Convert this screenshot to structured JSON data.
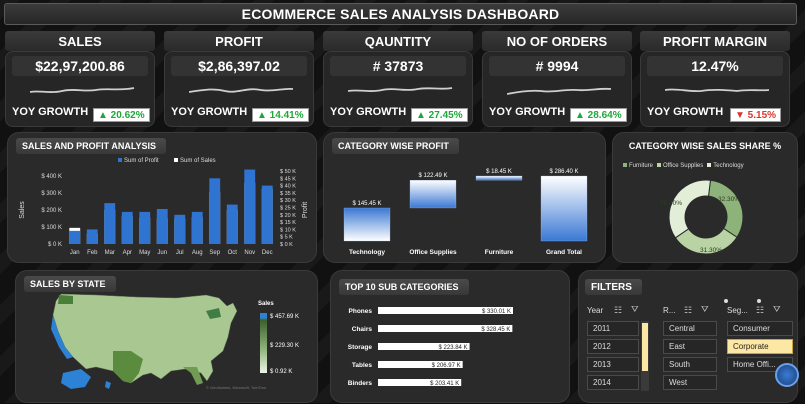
{
  "title": "ECOMMERCE SALES ANALYSIS DASHBOARD",
  "kpis": [
    {
      "label": "SALES",
      "value": "$22,97,200.86",
      "yoy_label": "YOY GROWTH",
      "growth": "▲ 20.62%",
      "trend": "up"
    },
    {
      "label": "PROFIT",
      "value": "$2,86,397.02",
      "yoy_label": "YOY GROWTH",
      "growth": "▲ 14.41%",
      "trend": "up"
    },
    {
      "label": "QAUNTITY",
      "value": "# 37873",
      "yoy_label": "YOY GROWTH",
      "growth": "▲ 27.45%",
      "trend": "up"
    },
    {
      "label": "NO OF ORDERS",
      "value": "# 9994",
      "yoy_label": "YOY GROWTH",
      "growth": "▲ 28.64%",
      "trend": "up"
    },
    {
      "label": "PROFIT MARGIN",
      "value": "12.47%",
      "yoy_label": "YOY GROWTH",
      "growth": "▼ 5.15%",
      "trend": "down"
    }
  ],
  "sales_profit": {
    "title": "SALES AND PROFIT ANALYSIS",
    "legend_profit": "Sum of Profit",
    "legend_sales": "Sum of Sales",
    "ylabel_left": "Sales",
    "ylabel_right": "Profit",
    "left_ticks": [
      "$ 400 K",
      "$ 300 K",
      "$ 200 K",
      "$ 100 K",
      "$ 0 K"
    ],
    "right_ticks": [
      "$ 50 K",
      "$ 45 K",
      "$ 40 K",
      "$ 35 K",
      "$ 30 K",
      "$ 25 K",
      "$ 20 K",
      "$ 15 K",
      "$ 10 K",
      "$ 5 K",
      "$ 0 K"
    ]
  },
  "chart_data": [
    {
      "type": "bar",
      "title": "SALES AND PROFIT ANALYSIS",
      "xlabel": "",
      "ylabel": "Sales",
      "y2label": "Profit",
      "categories": [
        "Jan",
        "Feb",
        "Mar",
        "Apr",
        "May",
        "Jun",
        "Jul",
        "Aug",
        "Sep",
        "Oct",
        "Nov",
        "Dec"
      ],
      "series": [
        {
          "name": "Sum of Sales",
          "values": [
            95,
            60,
            200,
            165,
            155,
            150,
            150,
            160,
            305,
            200,
            360,
            325
          ],
          "axis": "left",
          "unit": "$ K",
          "color": "#ffffff"
        },
        {
          "name": "Sum of Profit",
          "values": [
            9,
            10,
            28,
            22,
            22,
            24,
            20,
            22,
            45,
            27,
            51,
            40
          ],
          "axis": "right",
          "unit": "$ K",
          "color": "#2f74d0"
        }
      ],
      "ylim": [
        0,
        400
      ],
      "y2lim": [
        0,
        50
      ]
    },
    {
      "type": "bar",
      "subtype": "waterfall",
      "title": "CATEGORY WISE PROFIT",
      "categories": [
        "Technology",
        "Office Supplies",
        "Furniture",
        "Grand Total"
      ],
      "values": [
        145.45,
        122.49,
        18.45,
        286.4
      ],
      "labels": [
        "$ 145.45 K",
        "$ 122.49 K",
        "$ 18.45 K",
        "$ 286.40 K"
      ]
    },
    {
      "type": "pie",
      "subtype": "donut",
      "title": "CATEGORY WISE SALES SHARE %",
      "categories": [
        "Furniture",
        "Office Supplies",
        "Technology"
      ],
      "values": [
        32.3,
        31.3,
        36.4
      ],
      "labels": [
        "32.30%",
        "31.30%",
        "36.40%"
      ],
      "colors": [
        "#8eb37a",
        "#b9d3a4",
        "#e3eed9"
      ]
    },
    {
      "type": "bar",
      "subtype": "horizontal",
      "title": "TOP 10 SUB CATEGORIES",
      "categories": [
        "Phones",
        "Chairs",
        "Storage",
        "Tables",
        "Binders"
      ],
      "values": [
        330.01,
        328.45,
        223.84,
        206.97,
        203.41
      ],
      "labels": [
        "$ 330.01 K",
        "$ 328.45 K",
        "$ 223.84 K",
        "$ 206.97 K",
        "$ 203.41 K"
      ]
    }
  ],
  "category_profit": {
    "title": "CATEGORY WISE PROFIT"
  },
  "category_share": {
    "title": "CATEGORY WISE SALES SHARE %",
    "legend": [
      "Furniture",
      "Office Supplies",
      "Technology"
    ]
  },
  "sales_by_state": {
    "title": "SALES BY STATE",
    "legend_title": "Sales",
    "legend_max": "$ 457.69 K",
    "legend_mid": "$ 229.30 K",
    "legend_min": "$ 0.92 K",
    "attribution": "© GeoNames, Microsoft, TomTom"
  },
  "top_sub": {
    "title": "TOP 10 SUB CATEGORIES"
  },
  "filters": {
    "title": "FILTERS",
    "year": {
      "header": "Year",
      "items": [
        "2011",
        "2012",
        "2013",
        "2014"
      ]
    },
    "region": {
      "header": "R...",
      "items": [
        "Central",
        "East",
        "South",
        "West"
      ]
    },
    "segment": {
      "header": "Seg...",
      "items": [
        "Consumer",
        "Corporate",
        "Home Offi..."
      ],
      "selected": "Corporate"
    }
  }
}
